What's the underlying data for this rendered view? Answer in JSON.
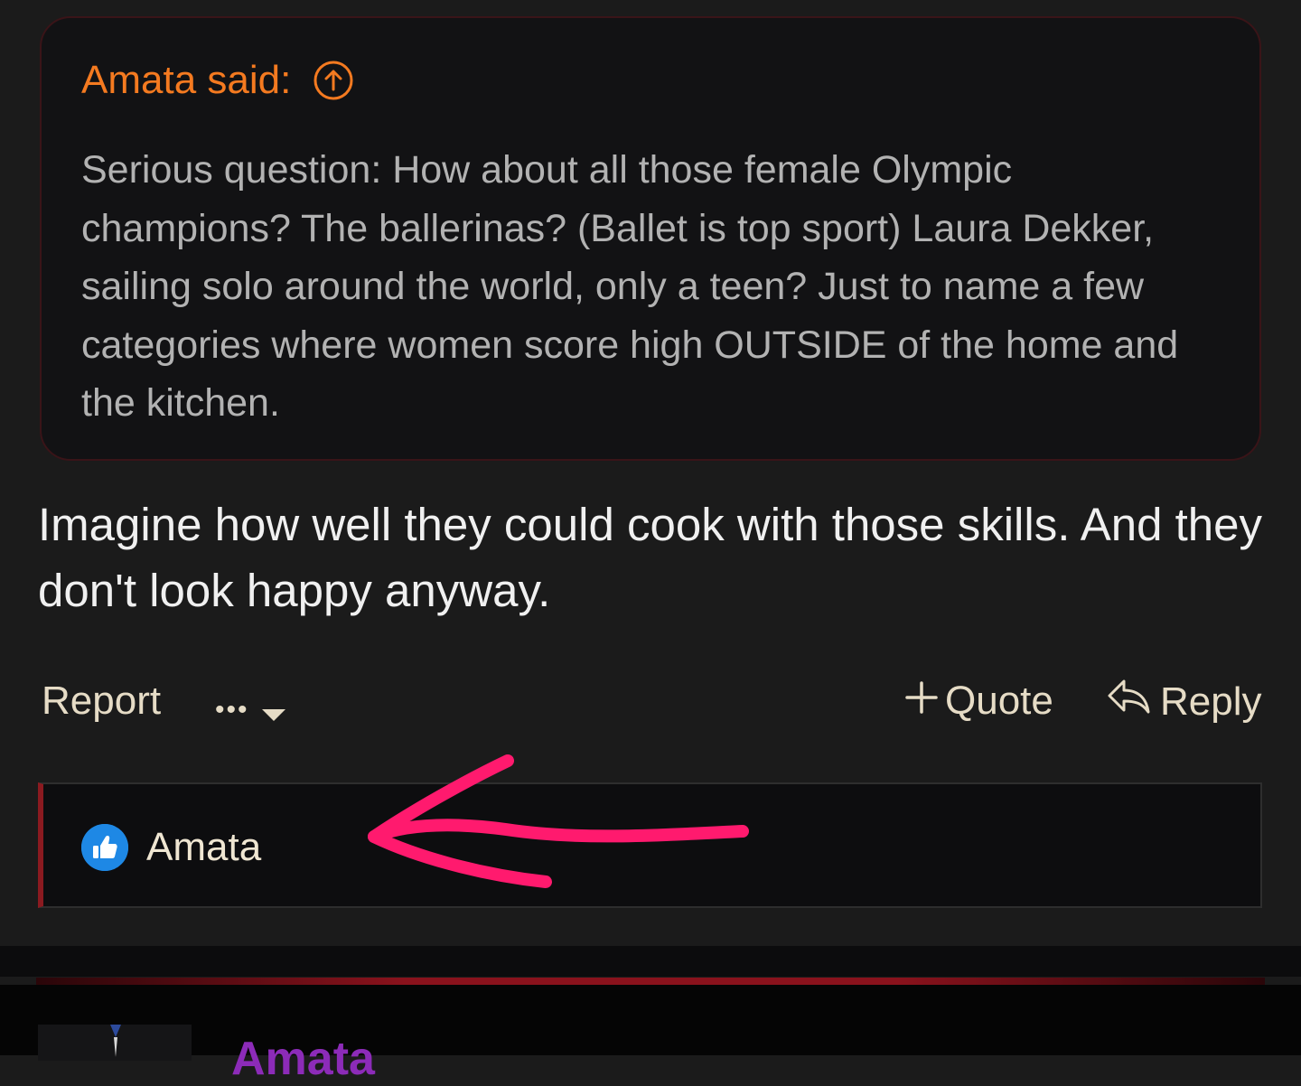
{
  "quote": {
    "author_said": "Amata said:",
    "text": "Serious question: How about all those female Olympic champions? The ballerinas? (Ballet is top sport) Laura Dekker, sailing solo around the world, only a teen? Just to name a few categories where women score high OUTSIDE of the home and the kitchen."
  },
  "post": {
    "body": "Imagine how well they could cook with those skills. And they don't look happy anyway."
  },
  "actions": {
    "report": "Report",
    "more": "•••",
    "quote": "Quote",
    "reply": "Reply"
  },
  "reactions": {
    "user": "Amata",
    "icon": "thumbs-up-icon"
  },
  "next_post": {
    "username": "Amata"
  },
  "colors": {
    "quote_author": "#f47a20",
    "annotation_arrow": "#ff1a6e",
    "next_username": "#8c2bb8"
  }
}
